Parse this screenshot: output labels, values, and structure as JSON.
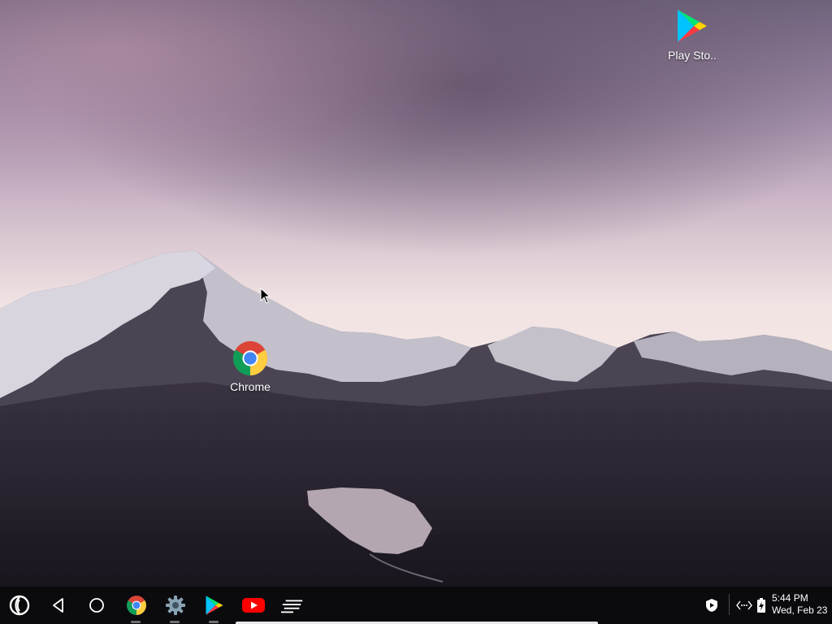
{
  "desktop": {
    "icons": [
      {
        "label": "Play Sto..",
        "icon": "play-store-icon"
      },
      {
        "label": "Chrome",
        "icon": "chrome-icon"
      }
    ]
  },
  "taskbar": {
    "launcher_icon": "launcher-icon",
    "nav": [
      "back-icon",
      "home-icon"
    ],
    "pinned_apps": [
      "chrome-icon",
      "settings-icon",
      "play-store-icon",
      "youtube-icon",
      "all-apps-icon"
    ]
  },
  "tray": {
    "icons": [
      "shield-icon",
      "network-icon",
      "battery-charging-icon"
    ],
    "time": "5:44 PM",
    "date": "Wed, Feb 23"
  },
  "colors": {
    "taskbar_bg": "#0b0b0e",
    "youtube_red": "#ff0000",
    "chrome_blue": "#4285f4"
  }
}
